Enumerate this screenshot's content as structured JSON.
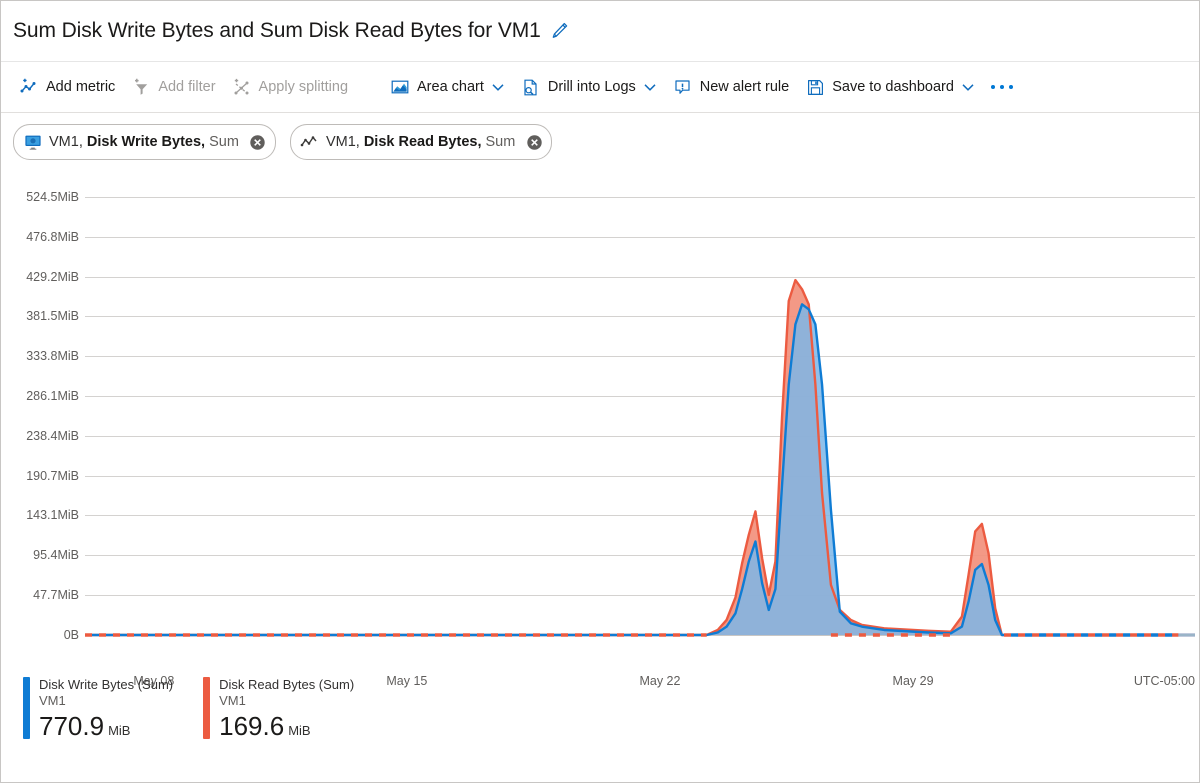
{
  "header": {
    "title": "Sum Disk Write Bytes and Sum Disk Read Bytes for VM1",
    "edit_icon": "pencil-icon"
  },
  "toolbar": {
    "items": [
      {
        "id": "add-metric",
        "label": "Add metric",
        "icon": "add-metric-icon",
        "disabled": false,
        "chevron": false
      },
      {
        "id": "add-filter",
        "label": "Add filter",
        "icon": "add-filter-icon",
        "disabled": true,
        "chevron": false
      },
      {
        "id": "apply-splitting",
        "label": "Apply splitting",
        "icon": "apply-splitting-icon",
        "disabled": true,
        "chevron": false
      },
      {
        "id": "area-chart",
        "label": "Area chart",
        "icon": "area-chart-icon",
        "disabled": false,
        "chevron": true
      },
      {
        "id": "drill-into-logs",
        "label": "Drill into Logs",
        "icon": "drill-logs-icon",
        "disabled": false,
        "chevron": true
      },
      {
        "id": "new-alert-rule",
        "label": "New alert rule",
        "icon": "alert-rule-icon",
        "disabled": false,
        "chevron": false
      },
      {
        "id": "save-to-dashboard",
        "label": "Save to dashboard",
        "icon": "save-icon",
        "disabled": false,
        "chevron": true
      }
    ],
    "overflow_label": "More commands"
  },
  "chips": [
    {
      "id": "chip-disk-write",
      "icon": "vm-monitor-icon",
      "resource": "VM1,",
      "metric": "Disk Write Bytes,",
      "aggregation": "Sum",
      "close_icon": "close-circle-icon"
    },
    {
      "id": "chip-disk-read",
      "icon": "line-chart-icon",
      "resource": "VM1,",
      "metric": "Disk Read Bytes,",
      "aggregation": "Sum",
      "close_icon": "close-circle-icon"
    }
  ],
  "chart_data": {
    "type": "area",
    "title": "Sum Disk Write Bytes and Sum Disk Read Bytes for VM1",
    "xlabel": "",
    "ylabel": "",
    "grid": true,
    "legend_position": "bottom-left",
    "timezone_label": "UTC-05:00",
    "y_ticks": [
      "0B",
      "47.7MiB",
      "95.4MiB",
      "143.1MiB",
      "190.7MiB",
      "238.4MiB",
      "286.1MiB",
      "333.8MiB",
      "381.5MiB",
      "429.2MiB",
      "476.8MiB",
      "524.5MiB"
    ],
    "y_tick_values": [
      0,
      47.7,
      95.4,
      143.1,
      190.7,
      238.4,
      286.1,
      333.8,
      381.5,
      429.2,
      476.8,
      524.5
    ],
    "ylim": [
      0,
      524.5
    ],
    "y_unit": "MiB",
    "x_ticks": [
      "May 08",
      "May 15",
      "May 22",
      "May 29"
    ],
    "x_tick_positions": [
      0.062,
      0.29,
      0.518,
      0.746
    ],
    "xlim_labels": [
      "May 05",
      "Jun 02"
    ],
    "series": [
      {
        "name": "Disk Write Bytes (Sum)",
        "resource": "VM1",
        "color": "#0f7cd4",
        "fill": "#7db6e8",
        "style": "area-dashed-baseline",
        "x": [
          0.0,
          0.56,
          0.57,
          0.578,
          0.586,
          0.592,
          0.598,
          0.604,
          0.61,
          0.616,
          0.622,
          0.628,
          0.634,
          0.64,
          0.646,
          0.652,
          0.658,
          0.664,
          0.672,
          0.68,
          0.69,
          0.7,
          0.72,
          0.76,
          0.78,
          0.79,
          0.796,
          0.802,
          0.808,
          0.814,
          0.82,
          0.826,
          1.0
        ],
        "y": [
          0,
          0,
          3,
          10,
          26,
          55,
          88,
          112,
          62,
          30,
          55,
          180,
          300,
          372,
          396,
          390,
          372,
          300,
          150,
          28,
          14,
          10,
          6,
          3,
          2,
          10,
          40,
          78,
          85,
          60,
          18,
          0,
          0
        ]
      },
      {
        "name": "Disk Read Bytes (Sum)",
        "resource": "VM1",
        "color": "#ec5b41",
        "fill": "#f2907c",
        "style": "area-dashed-baseline",
        "x": [
          0.0,
          0.56,
          0.57,
          0.578,
          0.586,
          0.592,
          0.598,
          0.604,
          0.61,
          0.616,
          0.622,
          0.628,
          0.634,
          0.64,
          0.646,
          0.652,
          0.658,
          0.664,
          0.672,
          0.68,
          0.69,
          0.7,
          0.72,
          0.76,
          0.78,
          0.79,
          0.796,
          0.802,
          0.808,
          0.814,
          0.82,
          0.826,
          1.0
        ],
        "y": [
          0,
          0,
          6,
          18,
          45,
          86,
          120,
          148,
          92,
          48,
          88,
          262,
          400,
          425,
          414,
          396,
          300,
          170,
          60,
          30,
          18,
          12,
          8,
          5,
          4,
          22,
          72,
          124,
          133,
          98,
          32,
          0,
          0
        ]
      }
    ]
  },
  "legend": [
    {
      "id": "legend-disk-write",
      "title": "Disk Write Bytes (Sum)",
      "resource": "VM1",
      "value": "770.9",
      "unit": "MiB",
      "color": "#0f7cd4"
    },
    {
      "id": "legend-disk-read",
      "title": "Disk Read Bytes (Sum)",
      "resource": "VM1",
      "value": "169.6",
      "unit": "MiB",
      "color": "#ec5b41"
    }
  ],
  "colors": {
    "accent": "#0078d4",
    "blue_series": "#0f7cd4",
    "blue_fill": "#7db6e8",
    "red_series": "#ec5b41",
    "red_fill": "#f2907c",
    "grid": "#d4d2d0",
    "text": "#1b1a19",
    "text_secondary": "#605e5c",
    "text_disabled": "#a19f9d"
  }
}
